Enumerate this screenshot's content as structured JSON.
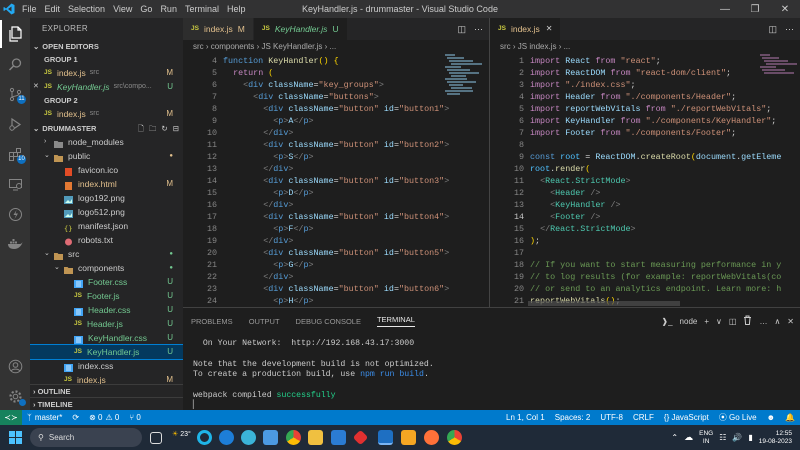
{
  "window": {
    "title": "KeyHandler.js - drummaster - Visual Studio Code",
    "menu": [
      "File",
      "Edit",
      "Selection",
      "View",
      "Go",
      "Run",
      "Terminal",
      "Help"
    ],
    "controls": [
      "—",
      "❐",
      "✕"
    ]
  },
  "activity": {
    "scm_badge": "11",
    "ext_badge": "10"
  },
  "sidebar": {
    "title": "EXPLORER",
    "open_editors_label": "OPEN EDITORS",
    "group1_label": "GROUP 1",
    "group2_label": "GROUP 2",
    "project_label": "DRUMMASTER",
    "outline_label": "OUTLINE",
    "timeline_label": "TIMELINE",
    "open_g1": [
      {
        "icon": "JS",
        "name": "index.js",
        "sub": "src",
        "status": "M"
      },
      {
        "icon": "JS",
        "name": "KeyHandler.js",
        "sub": "src\\compo...",
        "status": "U",
        "close": "✕"
      }
    ],
    "open_g2": [
      {
        "icon": "JS",
        "name": "index.js",
        "sub": "src",
        "status": "M"
      }
    ],
    "tree": [
      {
        "name": "node_modules",
        "kind": "folder",
        "indent": 1
      },
      {
        "name": "public",
        "kind": "folder-open",
        "indent": 1
      },
      {
        "name": "favicon.ico",
        "kind": "ico",
        "indent": 2
      },
      {
        "name": "index.html",
        "kind": "html",
        "indent": 2,
        "status": "M"
      },
      {
        "name": "logo192.png",
        "kind": "img",
        "indent": 2
      },
      {
        "name": "logo512.png",
        "kind": "img",
        "indent": 2
      },
      {
        "name": "manifest.json",
        "kind": "json",
        "indent": 2
      },
      {
        "name": "robots.txt",
        "kind": "txt",
        "indent": 2
      },
      {
        "name": "src",
        "kind": "folder-open",
        "indent": 1
      },
      {
        "name": "components",
        "kind": "folder-open",
        "indent": 2
      },
      {
        "name": "Footer.css",
        "kind": "css",
        "indent": 3,
        "status": "U"
      },
      {
        "name": "Footer.js",
        "kind": "js",
        "indent": 3,
        "status": "U"
      },
      {
        "name": "Header.css",
        "kind": "css",
        "indent": 3,
        "status": "U"
      },
      {
        "name": "Header.js",
        "kind": "js",
        "indent": 3,
        "status": "U"
      },
      {
        "name": "KeyHandler.css",
        "kind": "css",
        "indent": 3,
        "status": "U"
      },
      {
        "name": "KeyHandler.js",
        "kind": "js",
        "indent": 3,
        "status": "U",
        "selected": true
      },
      {
        "name": "index.css",
        "kind": "css",
        "indent": 2
      },
      {
        "name": "index.js",
        "kind": "js",
        "indent": 2,
        "status": "M"
      }
    ]
  },
  "editor_left": {
    "tabs": [
      {
        "icon": "JS",
        "label": "index.js",
        "status": "M"
      },
      {
        "icon": "JS",
        "label": "KeyHandler.js",
        "status": "U",
        "active": true
      }
    ],
    "breadcrumb": [
      "src",
      "components",
      "JS KeyHandler.js",
      "..."
    ],
    "lines": [
      {
        "n": "4",
        "t": "function KeyHandler() {"
      },
      {
        "n": "5",
        "t": "  return ("
      },
      {
        "n": "6",
        "t": "    <div className=\"key_groups\">"
      },
      {
        "n": "7",
        "t": "      <div className=\"buttons\">"
      },
      {
        "n": "8",
        "t": "        <div className=\"button\" id=\"button1\">"
      },
      {
        "n": "9",
        "t": "          <p>A</p>"
      },
      {
        "n": "10",
        "t": "        </div>"
      },
      {
        "n": "11",
        "t": "        <div className=\"button\" id=\"button2\">"
      },
      {
        "n": "12",
        "t": "          <p>S</p>"
      },
      {
        "n": "13",
        "t": "        </div>"
      },
      {
        "n": "14",
        "t": "        <div className=\"button\" id=\"button3\">"
      },
      {
        "n": "15",
        "t": "          <p>D</p>"
      },
      {
        "n": "16",
        "t": "        </div>"
      },
      {
        "n": "17",
        "t": "        <div className=\"button\" id=\"button4\">"
      },
      {
        "n": "18",
        "t": "          <p>F</p>"
      },
      {
        "n": "19",
        "t": "        </div>"
      },
      {
        "n": "20",
        "t": "        <div className=\"button\" id=\"button5\">"
      },
      {
        "n": "21",
        "t": "          <p>G</p>"
      },
      {
        "n": "22",
        "t": "        </div>"
      },
      {
        "n": "23",
        "t": "        <div className=\"button\" id=\"button6\">"
      },
      {
        "n": "24",
        "t": "          <p>H</p>"
      }
    ]
  },
  "editor_right": {
    "tabs": [
      {
        "icon": "JS",
        "label": "index.js",
        "status": "M",
        "active": true,
        "close": "✕"
      }
    ],
    "breadcrumb": [
      "src",
      "JS index.js",
      "..."
    ],
    "lines": [
      {
        "n": "1",
        "t": "import React from \"react\";"
      },
      {
        "n": "2",
        "t": "import ReactDOM from \"react-dom/client\";"
      },
      {
        "n": "3",
        "t": "import \"./index.css\";"
      },
      {
        "n": "4",
        "t": "import Header from \"./components/Header\";"
      },
      {
        "n": "5",
        "t": "import reportWebVitals from \"./reportWebVitals\";"
      },
      {
        "n": "6",
        "t": "import KeyHandler from \"./components/KeyHandler\";"
      },
      {
        "n": "7",
        "t": "import Footer from \"./components/Footer\";"
      },
      {
        "n": "8",
        "t": ""
      },
      {
        "n": "9",
        "t": "const root = ReactDOM.createRoot(document.getEleme"
      },
      {
        "n": "10",
        "t": "root.render("
      },
      {
        "n": "11",
        "t": "  <React.StrictMode>"
      },
      {
        "n": "12",
        "t": "    <Header />"
      },
      {
        "n": "13",
        "t": "    <KeyHandler />"
      },
      {
        "n": "14",
        "t": "    <Footer />"
      },
      {
        "n": "15",
        "t": "  </React.StrictMode>"
      },
      {
        "n": "16",
        "t": ");"
      },
      {
        "n": "17",
        "t": ""
      },
      {
        "n": "18",
        "t": "// If you want to start measuring performance in y"
      },
      {
        "n": "19",
        "t": "// to log results (for example: reportWebVitals(co"
      },
      {
        "n": "20",
        "t": "// or send to an analytics endpoint. Learn more: h"
      },
      {
        "n": "21",
        "t": "reportWebVitals();"
      }
    ]
  },
  "panel": {
    "tabs": [
      "PROBLEMS",
      "OUTPUT",
      "DEBUG CONSOLE",
      "TERMINAL"
    ],
    "active": "TERMINAL",
    "shell": "node",
    "controls": [
      "+",
      "∨",
      "◫",
      "🗑",
      "…",
      "∧",
      "✕"
    ],
    "terminal": {
      "network_label": "  On Your Network:  ",
      "network_url": "http://192.168.43.17:3000",
      "note1": "Note that the development build is not optimized.",
      "note2a": "To create a production build, use ",
      "note2b": "npm run build",
      "note2c": ".",
      "compiled_a": "webpack compiled ",
      "compiled_b": "successfully",
      "cursor": "▏"
    }
  },
  "statusbar": {
    "branch": "master*",
    "sync": "⟳",
    "errors": "⊗ 0",
    "warnings": "⚠ 0",
    "ports": "⑂ 0",
    "position": "Ln 1, Col 1",
    "spaces": "Spaces: 2",
    "encoding": "UTF-8",
    "eol": "CRLF",
    "language": "{} JavaScript",
    "golive": "⦿ Go Live",
    "notif": "🔔"
  },
  "taskbar": {
    "search": "Search",
    "temp": "23°",
    "lang": "ENG",
    "region": "IN",
    "time": "12:55",
    "date": "19-08-2023"
  },
  "colors": {
    "accent": "#007acc",
    "remote": "#16825d",
    "untracked": "#73c991",
    "modified": "#e2c08d"
  }
}
